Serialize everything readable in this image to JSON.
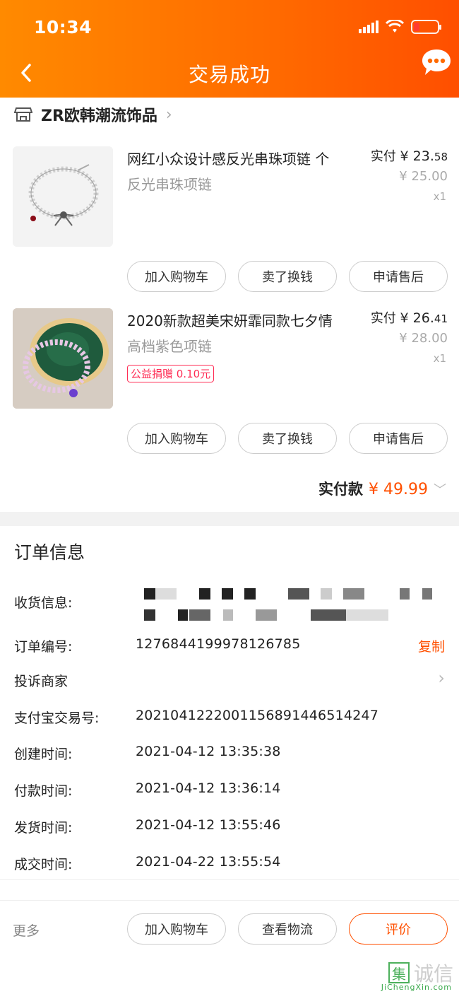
{
  "status_bar": {
    "time": "10:34"
  },
  "header": {
    "title": "交易成功"
  },
  "shop": {
    "name": "ZR欧韩潮流饰品"
  },
  "items": [
    {
      "title": "网红小众设计感反光串珠项链 个",
      "spec": "反光串珠项链",
      "paid_label": "实付",
      "paid_int": "¥ 23.",
      "paid_dec": "58",
      "original": "¥ 25.00",
      "qty": "x1",
      "buttons": [
        "加入购物车",
        "卖了换钱",
        "申请售后"
      ]
    },
    {
      "title": "2020新款超美宋妍霏同款七夕情",
      "spec": "高档紫色项链",
      "badge": "公益捐赠 0.10元",
      "paid_label": "实付",
      "paid_int": "¥ 26.",
      "paid_dec": "41",
      "original": "¥ 28.00",
      "qty": "x1",
      "buttons": [
        "加入购物车",
        "卖了换钱",
        "申请售后"
      ]
    }
  ],
  "total": {
    "label": "实付款",
    "amount": "¥ 49.99"
  },
  "order_info": {
    "title": "订单信息",
    "shipping_label": "收货信息:",
    "order_no_label": "订单编号:",
    "order_no": "1276844199978126785",
    "copy": "复制",
    "complain": "投诉商家",
    "alipay_label": "支付宝交易号:",
    "alipay_no": "2021041222001156891446514247",
    "create_label": "创建时间:",
    "create_time": "2021-04-12 13:35:38",
    "pay_label": "付款时间:",
    "pay_time": "2021-04-12 13:36:14",
    "ship_label": "发货时间:",
    "ship_time": "2021-04-12 13:55:46",
    "deal_label": "成交时间:",
    "deal_time": "2021-04-22 13:55:54"
  },
  "bottom_bar": {
    "more": "更多",
    "buttons": [
      "加入购物车",
      "查看物流",
      "评价"
    ]
  },
  "watermark": {
    "text": "诚信",
    "url": "JiChengXin.com"
  },
  "colors": {
    "accent": "#ff5000",
    "header_start": "#ff8a00",
    "header_end": "#ff4f00"
  }
}
